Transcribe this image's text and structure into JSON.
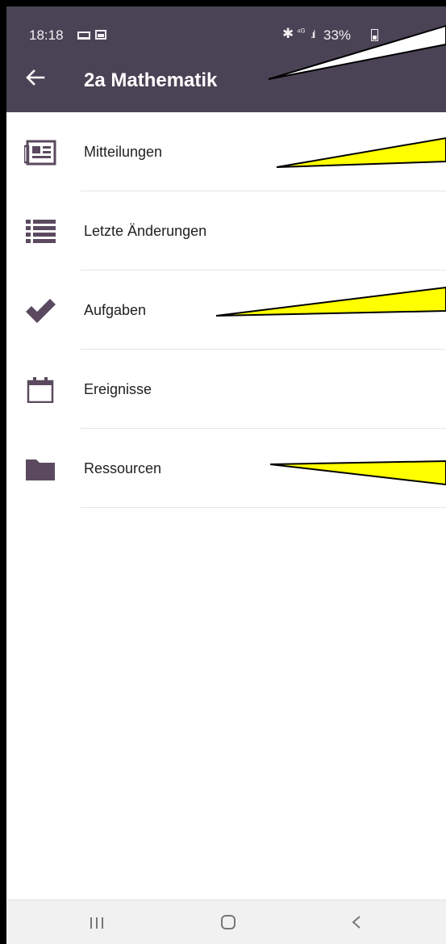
{
  "status_bar": {
    "time": "18:18",
    "battery": "33%"
  },
  "app_bar": {
    "title": "2a Mathematik",
    "background": "#4a4355"
  },
  "menu": {
    "items": [
      {
        "label": "Mitteilungen",
        "icon": "newspaper-icon"
      },
      {
        "label": "Letzte Änderungen",
        "icon": "list-icon"
      },
      {
        "label": "Aufgaben",
        "icon": "checkmark-icon"
      },
      {
        "label": "Ereignisse",
        "icon": "calendar-icon"
      },
      {
        "label": "Ressourcen",
        "icon": "folder-icon"
      }
    ],
    "icon_color": "#5b4a5f"
  },
  "nav_bar": {
    "recents": "recents-icon",
    "home": "home-icon",
    "back": "back-nav-icon"
  },
  "callout_color": "#ffff00"
}
